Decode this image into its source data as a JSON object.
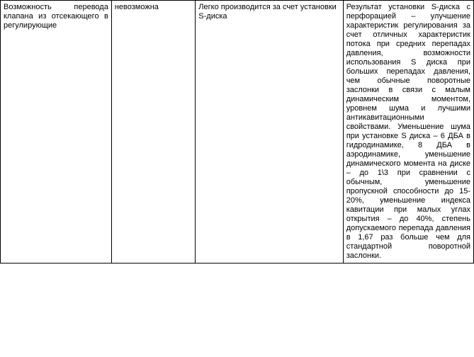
{
  "table": {
    "row": {
      "param": "Возможность перевода клапана из отсекающего в регулирующие",
      "val1": "невозможна",
      "val2": "Легко производится за счет установки S-диска",
      "val3": "Результат установки S-диска с перфорацией – улучшение характеристик регулирования за счет отличных характеристик потока при средних перепадах давления, возможности использования S диска при больших перепадах давления, чем обычные поворотные заслонки в связи с малым динамическим моментом, уровнем шума и лучшими антикавитационными свойствами. Уменьшение шума при установке S диска – 6 ДБА в гидродинамике, 8 ДБА в аэродинамике, уменьшение динамического момента на диске – до 1\\3 при сравнении с обычным, уменьшение пропускной способности до 15-20%, уменьшение индекса кавитации при малых углах открытия – до 40%, степень допускаемого перепада давления в 1,67 раз больше чем для стандартной поворотной заслонки."
    }
  }
}
